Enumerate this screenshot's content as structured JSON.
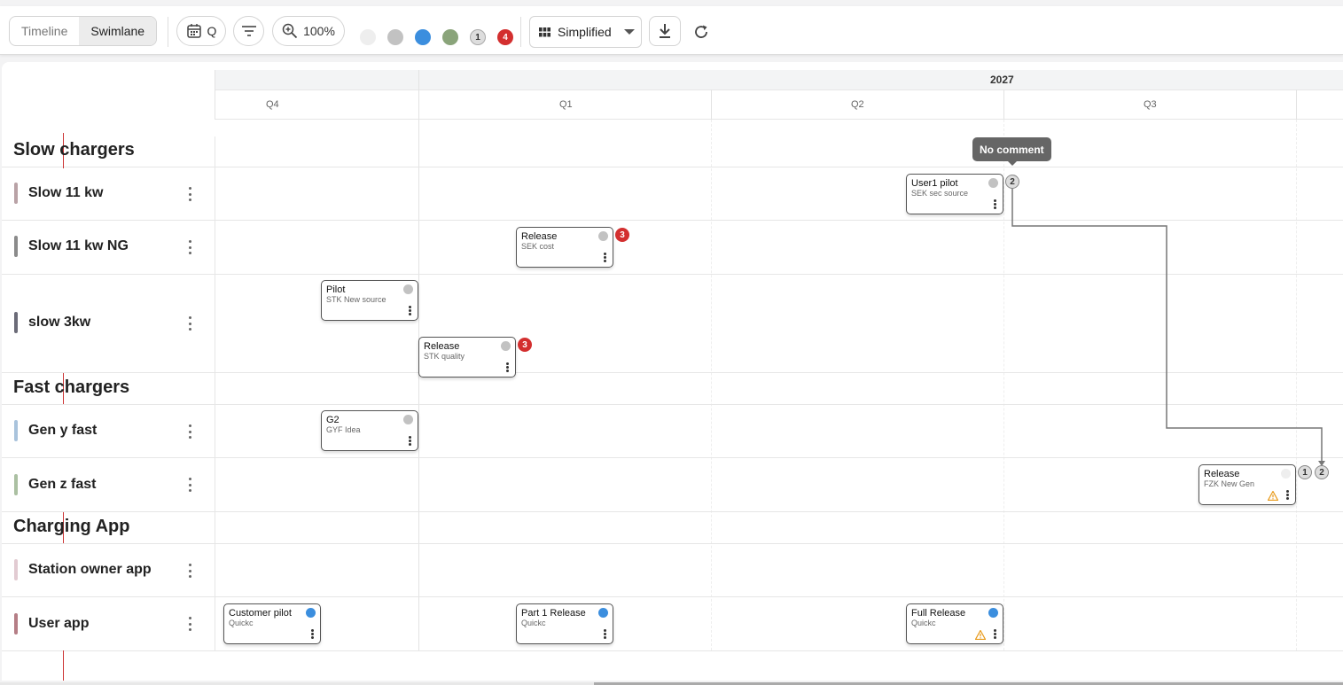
{
  "toolbar": {
    "view_timeline": "Timeline",
    "view_swimlane": "Swimlane",
    "period_label": "Q",
    "zoom_label": "100%",
    "status_dots": [
      "#eeeeee",
      "#c2c2c2",
      "#3b8ede",
      "#8aa47a"
    ],
    "count_grey": "1",
    "count_red": "4",
    "mode_label": "Simplified"
  },
  "timeline": {
    "year": "2027",
    "quarters": [
      "Q4",
      "Q1",
      "Q2",
      "Q3"
    ]
  },
  "groups": [
    {
      "title": "Slow chargers",
      "lanes": [
        {
          "label": "Slow 11 kw",
          "color": "#b9a2a6"
        },
        {
          "label": "Slow 11 kw NG",
          "color": "#8b8b8b"
        },
        {
          "label": "slow 3kw",
          "color": "#6b6b78"
        }
      ]
    },
    {
      "title": "Fast chargers",
      "lanes": [
        {
          "label": "Gen y fast",
          "color": "#a9c3dc"
        },
        {
          "label": "Gen z fast",
          "color": "#abc0a2"
        }
      ]
    },
    {
      "title": "Charging App",
      "lanes": [
        {
          "label": "Station owner app",
          "color": "#e2cbd2"
        },
        {
          "label": "User app",
          "color": "#b57e86"
        }
      ]
    }
  ],
  "cards": [
    {
      "title": "User1 pilot",
      "subtitle": "SEK sec source",
      "status_color": "#c2c2c2"
    },
    {
      "title": "Release",
      "subtitle": "SEK cost",
      "status_color": "#c2c2c2",
      "badge": "3"
    },
    {
      "title": "Pilot",
      "subtitle": "STK New source",
      "status_color": "#c2c2c2"
    },
    {
      "title": "Release",
      "subtitle": "STK quality",
      "status_color": "#c2c2c2",
      "badge": "3"
    },
    {
      "title": "G2",
      "subtitle": "GYF Idea",
      "status_color": "#c2c2c2"
    },
    {
      "title": "Release",
      "subtitle": "FZK New Gen",
      "status_color": "#eeeeee"
    },
    {
      "title": "Customer pilot",
      "subtitle": "Quickc",
      "status_color": "#3b8ede"
    },
    {
      "title": "Part 1 Release",
      "subtitle": "Quickc",
      "status_color": "#3b8ede"
    },
    {
      "title": "Full Release",
      "subtitle": "Quickc",
      "status_color": "#3b8ede"
    }
  ],
  "dependency": {
    "from_badge": "2",
    "to_badge_a": "1",
    "to_badge_b": "2",
    "tooltip": "No comment"
  }
}
